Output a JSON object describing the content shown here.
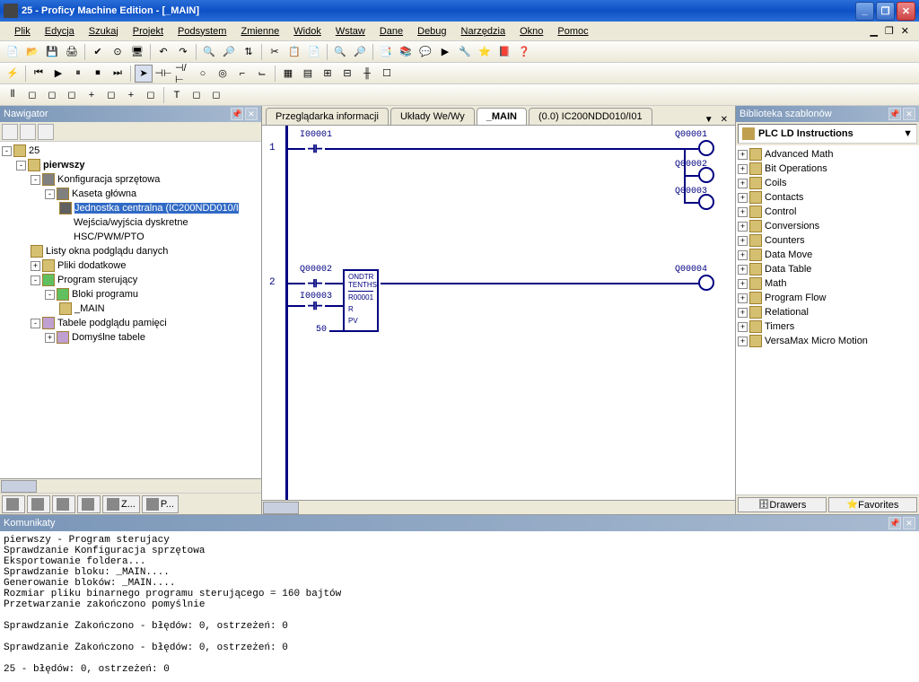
{
  "title": "25 - Proficy Machine Edition - [_MAIN]",
  "menu": [
    "Plik",
    "Edycja",
    "Szukaj",
    "Projekt",
    "Podsystem",
    "Zmienne",
    "Widok",
    "Wstaw",
    "Dane",
    "Debug",
    "Narzędzia",
    "Okno",
    "Pomoc"
  ],
  "panels": {
    "navigator": "Nawigator",
    "library": "Biblioteka szablonów",
    "messages": "Komunikaty"
  },
  "tree": {
    "root": "25",
    "project": "pierwszy",
    "items": [
      "Konfiguracja sprzętowa",
      "Kaseta główna",
      "Jednostka centralna (IC200NDD010/I",
      "Wejścia/wyjścia dyskretne",
      "HSC/PWM/PTO",
      "Listy okna podglądu danych",
      "Pliki dodatkowe",
      "Program sterujący",
      "Bloki programu",
      "_MAIN",
      "Tabele podglądu pamięci",
      "Domyślne tabele"
    ]
  },
  "nav_tabs": [
    "Z...",
    "P..."
  ],
  "doc_tabs": {
    "t1": "Przeglądarka informacji",
    "t2": "Układy We/Wy",
    "t3": "_MAIN",
    "t4": "(0.0) IC200NDD010/I01"
  },
  "ladder": {
    "i1": "I00001",
    "q1": "Q00001",
    "q2": "Q00002",
    "q3": "Q00003",
    "q4": "Q00004",
    "i3": "I00003",
    "pv": "50",
    "r_label": "R",
    "pv_label": "PV",
    "ondtr": "ONDTR\nTENTHS",
    "r": "R00001"
  },
  "lib_header": "PLC LD Instructions",
  "lib_items": [
    "Advanced Math",
    "Bit Operations",
    "Coils",
    "Contacts",
    "Control",
    "Conversions",
    "Counters",
    "Data Move",
    "Data Table",
    "Math",
    "Program Flow",
    "Relational",
    "Timers",
    "VersaMax Micro Motion"
  ],
  "lib_tabs": {
    "drawers": "Drawers",
    "fav": "Favorites"
  },
  "messages": "pierwszy - Program sterujacy\nSprawdzanie Konfiguracja sprzętowa\nEksportowanie foldera...\nSprawdzanie bloku: _MAIN....\nGenerowanie bloków: _MAIN....\nRozmiar pliku binarnego programu sterującego = 160 bajtów\nPrzetwarzanie zakończono pomyślnie\n\nSprawdzanie Zakończono - błędów: 0, ostrzeżeń: 0\n\nSprawdzanie Zakończono - błędów: 0, ostrzeżeń: 0\n\n25 - błędów: 0, ostrzeżeń: 0",
  "chart_data": {
    "type": "table",
    "title": "Ladder diagram _MAIN",
    "rungs": [
      {
        "n": 1,
        "inputs": [
          "I00001"
        ],
        "outputs": [
          "Q00001",
          "Q00002",
          "Q00003"
        ]
      },
      {
        "n": 2,
        "inputs": [
          "Q00002",
          "I00003"
        ],
        "block": {
          "type": "ONDTR TENTHS",
          "reg": "R00001",
          "pv": 50
        },
        "outputs": [
          "Q00004"
        ]
      }
    ]
  }
}
